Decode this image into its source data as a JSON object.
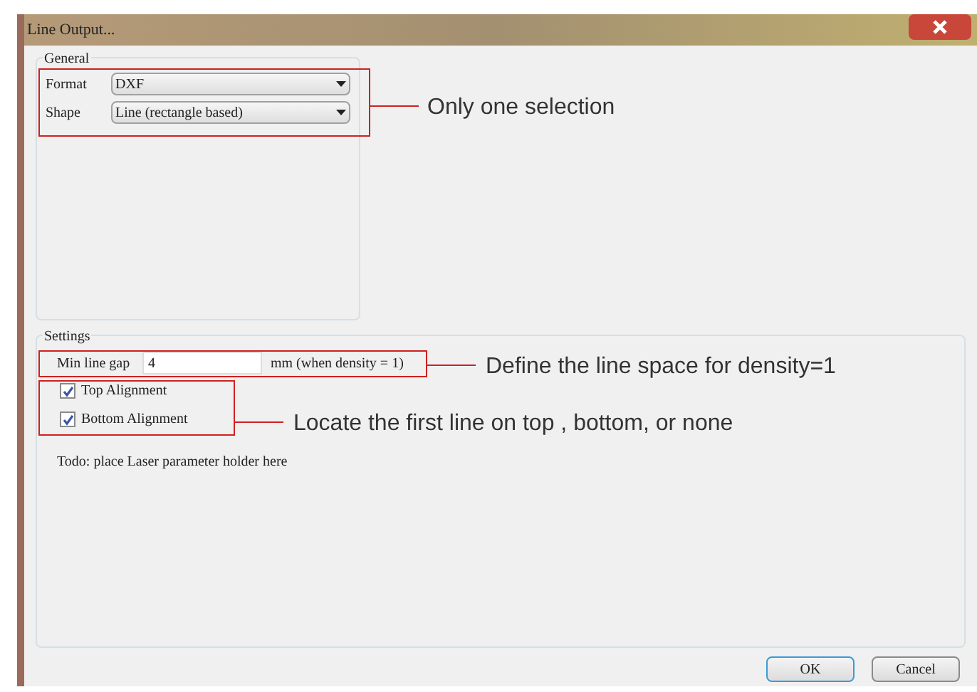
{
  "window": {
    "title": "Line Output..."
  },
  "general": {
    "title": "General",
    "fields": [
      {
        "label": "Format",
        "value": "DXF"
      },
      {
        "label": "Shape",
        "value": "Line (rectangle based)"
      }
    ],
    "note": "Only one selection"
  },
  "settings": {
    "title": "Settings",
    "gap": {
      "label": "Min line gap",
      "value": "4",
      "unit": "mm (when density = 1)",
      "note": "Define the line space for density=1"
    },
    "checkboxes": [
      {
        "label": "Top Alignment",
        "checked": true
      },
      {
        "label": "Bottom Alignment",
        "checked": true
      }
    ],
    "checkbox_note": "Locate the first line on top , bottom, or none",
    "todo": "Todo: place Laser parameter holder here"
  },
  "buttons": [
    {
      "label": "OK",
      "default": true
    },
    {
      "label": "Cancel",
      "default": false
    }
  ]
}
